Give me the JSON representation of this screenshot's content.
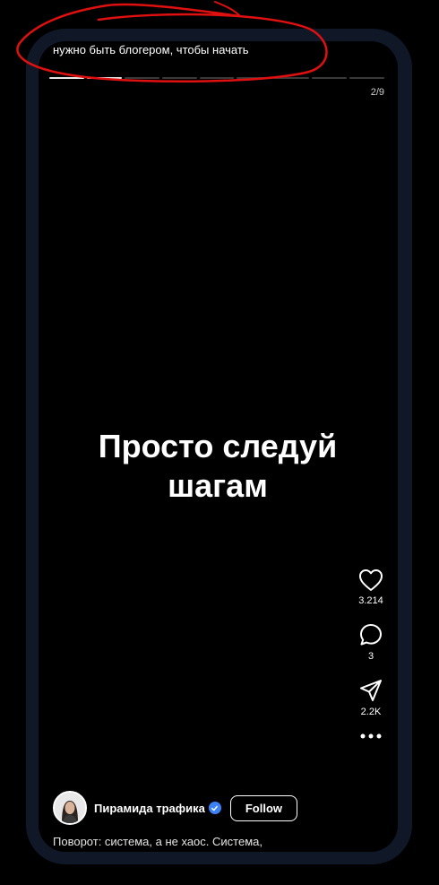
{
  "story": {
    "top_caption": "нужно быть блогером, чтобы начать",
    "progress": {
      "total": 9,
      "current": 2
    },
    "slide_counter": "2/9",
    "slide_text_line1": "Просто следуй",
    "slide_text_line2": "шагам"
  },
  "actions": {
    "like": {
      "icon": "heart-icon",
      "count": "3.214"
    },
    "comment": {
      "icon": "comment-icon",
      "count": "3"
    },
    "share": {
      "icon": "send-icon",
      "count": "2.2K"
    },
    "more": {
      "icon": "more-dots-icon"
    }
  },
  "author": {
    "name": "Пирамида трафика",
    "verified": true,
    "follow_label": "Follow"
  },
  "description": "Поворот: система, а не хаос. Система,",
  "colors": {
    "frame": "#101828",
    "background": "#000000",
    "verified_badge": "#3b82f6",
    "annotation": "#e01010"
  }
}
